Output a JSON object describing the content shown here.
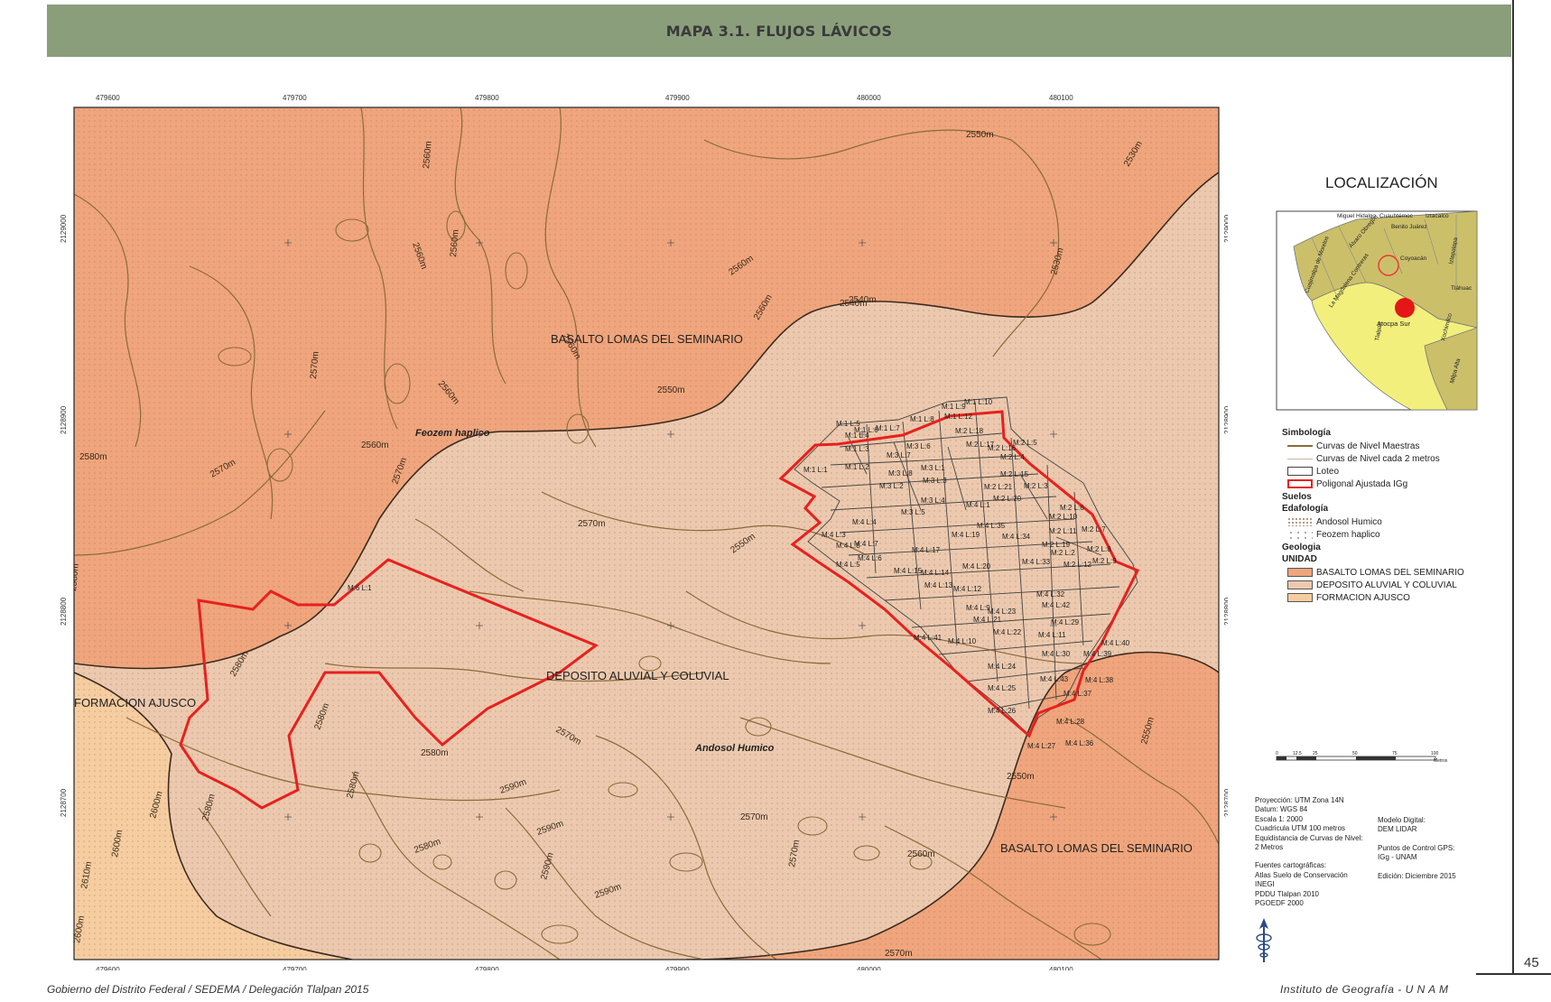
{
  "title": "MAPA 3.1. FLUJOS LÁVICOS",
  "page_number": "45",
  "footer": {
    "left": "Gobierno del Distrito Federal / SEDEMA / Delegación Tlalpan 2015",
    "right": "Instituto de Geografía - U N A M"
  },
  "map": {
    "coords_top": [
      "479600",
      "479700",
      "479800",
      "479900",
      "480000",
      "480100"
    ],
    "coords_side": [
      "2129000",
      "2128900",
      "2128800",
      "2128700"
    ],
    "units": [
      {
        "label": "BASALTO LOMAS DEL SEMINARIO",
        "color": "#f0a57c"
      },
      {
        "label": "DEPOSITO ALUVIAL Y COLUVIAL",
        "color": "#ecc9ae"
      },
      {
        "label": "FORMACION AJUSCO",
        "color": "#f6cda0"
      },
      {
        "label": "BASALTO LOMAS DEL SEMINARIO",
        "color": "#f0a57c"
      }
    ],
    "soil_labels": [
      "Feozem haplico",
      "Andosol Humico"
    ],
    "contour_labels": [
      "2550m",
      "2560m",
      "2530m",
      "2560m",
      "2560m",
      "2570m",
      "2560m",
      "2560m",
      "2540m",
      "2550m",
      "2560m",
      "2560m",
      "2570m",
      "2580m",
      "2570m",
      "2560m",
      "2550m",
      "2570m",
      "2580m",
      "2580m",
      "2580m",
      "2590m",
      "2590m",
      "2600m",
      "2610m",
      "2600m",
      "2570m",
      "2550m",
      "2560m",
      "2550m",
      "2570m",
      "2570m",
      "2570m",
      "2580m",
      "2580m",
      "2590m",
      "2580m",
      "2580m",
      "2600m",
      "2540m",
      "2530m",
      "2590m"
    ],
    "lot_labels": [
      "M:6 L:1",
      "M:1 L:1",
      "M:1 L:2",
      "M:1 L:3",
      "M:1 L:4",
      "M:1 L:5",
      "M:1 L:6",
      "M:1 L:7",
      "M:1 L:8",
      "M:1 L:9",
      "M:1 L:10",
      "M:1 L:12",
      "M:2 L:2",
      "M:2 L:3",
      "M:2 L:4",
      "M:2 L:5",
      "M:2 L:6",
      "M:2 L:7",
      "M:2 L:8",
      "M:2 L:9",
      "M:2 L:10",
      "M:2 L:11",
      "M:2 L:12",
      "M:2 L:15",
      "M:2 L:16",
      "M:2 L:17",
      "M:2 L:18",
      "M:2 L:19",
      "M:2 L:20",
      "M:2 L:21",
      "M:3 L:1",
      "M:3 L:2",
      "M:3 L:3",
      "M:3 L:4",
      "M:3 L:5",
      "M:3 L:6",
      "M:3 L:7",
      "M:3 L:8",
      "M:4 L:1",
      "M:4 L:3",
      "M:4 L:4",
      "M:4 L:5",
      "M:4 L:6",
      "M:4 L:7",
      "M:4 L:8",
      "M:4 L:9",
      "M:4 L:10",
      "M:4 L:11",
      "M:4 L:12",
      "M:4 L:13",
      "M:4 L:14",
      "M:4 L:15",
      "M:4 L:17",
      "M:4 L:19",
      "M:4 L:20",
      "M:4 L:21",
      "M:4 L:22",
      "M:4 L:23",
      "M:4 L:24",
      "M:4 L:25",
      "M:4 L:26",
      "M:4 L:27",
      "M:4 L:28",
      "M:4 L:29",
      "M:4 L:30",
      "M:4 L:32",
      "M:4 L:33",
      "M:4 L:34",
      "M:4 L:35",
      "M:4 L:36",
      "M:4 L:37",
      "M:4 L:38",
      "M:4 L:39",
      "M:4 L:40",
      "M:4 L:41",
      "M:4 L:42",
      "M:4 L:43"
    ]
  },
  "location": {
    "title": "LOCALIZACIÓN",
    "boroughs": [
      "Miguel Hidalgo",
      "Cuauhtémoc",
      "Iztacalco",
      "Benito Juárez",
      "Álvaro Obregón",
      "Coyoacán",
      "Cuajimalpa de Morelos",
      "La Magdalena Contreras",
      "Iztapalapa",
      "Tláhuac",
      "Xochimilco",
      "Tlalpan",
      "Milpa Alta",
      "Atocpa Sur"
    ]
  },
  "legend": {
    "title": "Simbología",
    "lines": [
      "Curvas de Nivel Maestras",
      "Curvas de Nivel cada 2 metros",
      "Loteo",
      "Poligonal Ajustada IGg"
    ],
    "soils_header": "Suelos",
    "edaf_header": "Edafología",
    "soils": [
      "Andosol Humico",
      "Feozem haplico"
    ],
    "geo_header": "Geologia",
    "unit_header": "UNIDAD",
    "units": [
      {
        "label": "BASALTO LOMAS DEL SEMINARIO",
        "color": "#f0a57c"
      },
      {
        "label": "DEPOSITO ALUVIAL Y COLUVIAL",
        "color": "#ecc9ae"
      },
      {
        "label": "FORMACION AJUSCO",
        "color": "#f6cda0"
      }
    ]
  },
  "scale": {
    "ticks": [
      "0",
      "12.5",
      "25",
      "50",
      "75",
      "100"
    ],
    "unit": "Metros"
  },
  "info": {
    "lines": [
      "Proyección: UTM Zona 14N",
      "Datum: WGS 84",
      "Escala 1:  2000",
      "Cuadricula UTM  100 metros",
      "Equidistancia de Curvas de Nivel:",
      "2 Metros",
      "",
      "Fuentes cartográficas:",
      "Atlas Suelo de Conservación",
      "INEGI",
      "PDDU Tlalpan 2010",
      "PGOEDF 2000"
    ],
    "right_lines": [
      "Modelo Digital:",
      "DEM LIDAR",
      "",
      "Puntos  de Control GPS:",
      "IGg - UNAM",
      "",
      "Edición: Diciembre 2015"
    ]
  }
}
